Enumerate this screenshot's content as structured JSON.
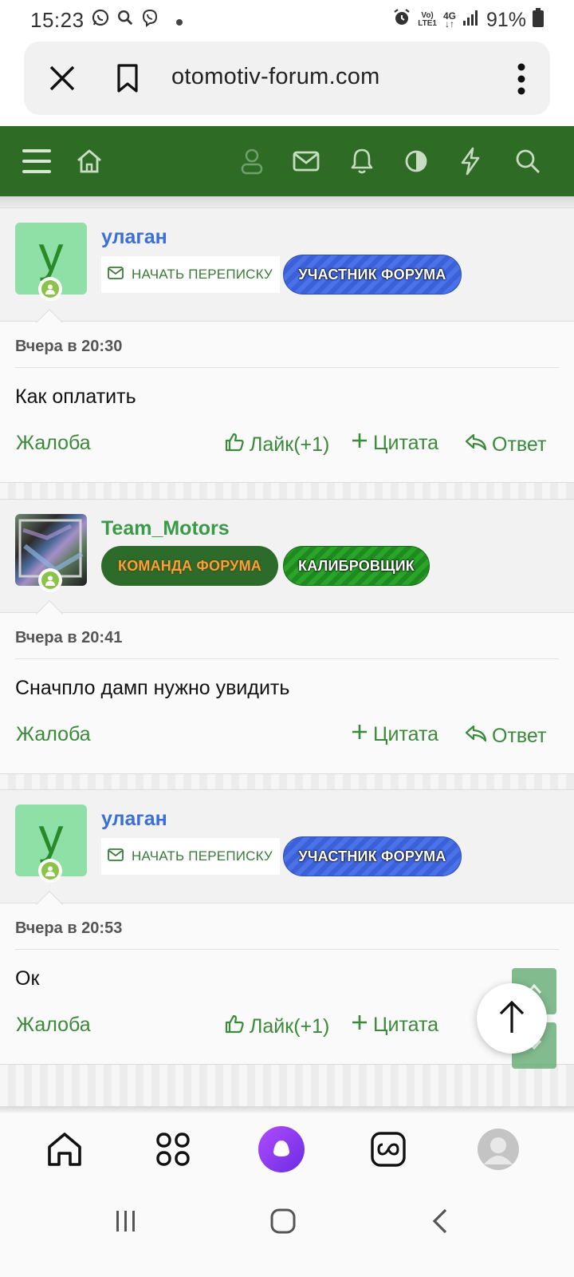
{
  "status_bar": {
    "time": "15:23",
    "battery": "91%",
    "network_top": "Vo)",
    "network_bottom": "LTE1",
    "signal_type": "4G"
  },
  "browser": {
    "url": "otomotiv-forum.com"
  },
  "nav_icons": [
    "menu-icon",
    "home-icon",
    "user-icon",
    "mail-icon",
    "bell-icon",
    "contrast-icon",
    "bolt-icon",
    "search-icon"
  ],
  "posts": [
    {
      "avatar_letter": "у",
      "username": "улаган",
      "message_button": "НАЧАТЬ ПЕРЕПИСКУ",
      "badges": [
        "УЧАСТНИК ФОРУМА"
      ],
      "date": "Вчера в 20:30",
      "text": "Как оплатить",
      "actions": {
        "report": "Жалоба",
        "like": "Лайк(+1)",
        "quote": "Цитата",
        "reply": "Ответ"
      }
    },
    {
      "username": "Team_Motors",
      "badges": [
        "КОМАНДА ФОРУМА",
        "КАЛИБРОВЩИК"
      ],
      "date": "Вчера в 20:41",
      "text": "Сначпло дамп нужно увидить",
      "actions": {
        "report": "Жалоба",
        "quote": "Цитата",
        "reply": "Ответ"
      }
    },
    {
      "avatar_letter": "у",
      "username": "улаган",
      "message_button": "НАЧАТЬ ПЕРЕПИСКУ",
      "badges": [
        "УЧАСТНИК ФОРУМА"
      ],
      "date": "Вчера в 20:53",
      "text": "Ок",
      "actions": {
        "report": "Жалоба",
        "like": "Лайк(+1)",
        "quote": "Цитата"
      }
    }
  ],
  "colors": {
    "nav_green": "#2e6b25",
    "link_green": "#3a8a3a",
    "username_blue": "#3a6fd8",
    "username_green": "#3a9a48",
    "alice_purple": "#8a3cf0"
  }
}
